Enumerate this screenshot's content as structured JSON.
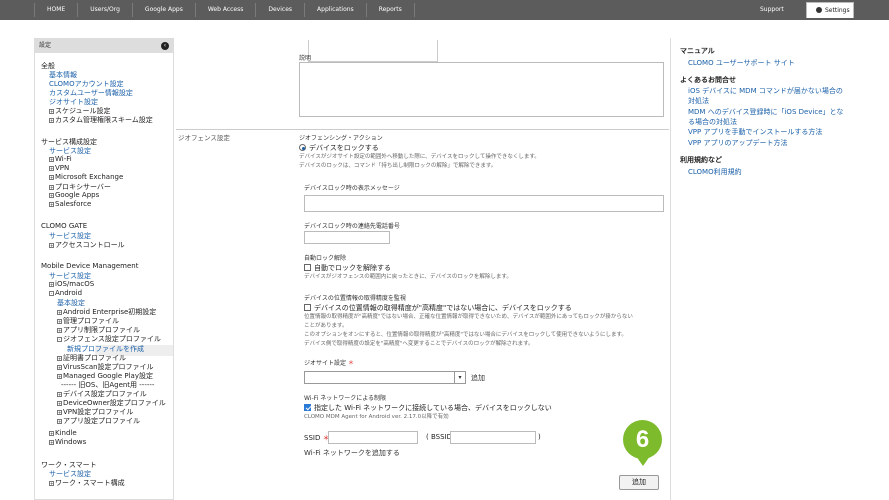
{
  "topnav": {
    "items": [
      "HOME",
      "Users/Org",
      "Google Apps",
      "Web Access",
      "Devices",
      "Applications",
      "Reports"
    ],
    "support": "Support",
    "settings": "Settings"
  },
  "sidebar": {
    "header": "設定",
    "general": {
      "title": "全般",
      "links": [
        "基本情報",
        "CLOMOアカウント設定",
        "カスタムユーザー情報設定",
        "ジオサイト設定"
      ],
      "items": [
        "スケジュール設定",
        "カスタム管理権限スキーム設定"
      ]
    },
    "service_config": {
      "title": "サービス構成設定",
      "link": "サービス設定",
      "items": [
        "Wi-Fi",
        "VPN",
        "Microsoft Exchange",
        "プロキシサーバー",
        "Google Apps",
        "Salesforce"
      ]
    },
    "gate": {
      "title": "CLOMO GATE",
      "link": "サービス設定",
      "items": [
        "アクセスコントロール"
      ]
    },
    "mdm": {
      "title": "Mobile Device Management",
      "link": "サービス設定",
      "ios": "iOS/macOS",
      "android": "Android",
      "android_basic": "基本設定",
      "android_items": [
        "Android Enterprise初期設定",
        "管理プロファイル",
        "アプリ制限プロファイル",
        "ジオフェンス設定プロファイル"
      ],
      "new_profile": "新規プロファイルを作成",
      "android_items2": [
        "証明書プロファイル",
        "VirusScan設定プロファイル",
        "Managed Google Play設定"
      ],
      "old_agent": "------ 旧OS、旧Agent用 ------",
      "android_items3": [
        "デバイス設定プロファイル",
        "DeviceOwner設定プロファイル",
        "VPN設定プロファイル",
        "アプリ設定プロファイル"
      ],
      "kindle": "Kindle",
      "windows": "Windows"
    },
    "ws": {
      "title": "ワーク・スマート",
      "link": "サービス設定",
      "items": [
        "ワーク・スマート構成"
      ]
    }
  },
  "main": {
    "description_label": "説明",
    "geofence_label": "ジオフェンス設定",
    "action_label": "ジオフェンシング・アクション",
    "lock_option": "デバイスをロックする",
    "lock_desc1": "デバイスがジオサイト設定の範囲外へ移動した際に、デバイスをロックして操作できなくします。",
    "lock_desc2": "デバイスのロックは、コマンド「持ち出し制限ロックの解除」で解除できます。",
    "lock_message_label": "デバイスロック時の表示メッセージ",
    "lock_phone_label": "デバイスロック時の連絡先電話番号",
    "auto_unlock_label": "自動ロック解除",
    "auto_unlock_option": "自動でロックを解除する",
    "auto_unlock_desc": "デバイスがジオフェンスの範囲内に戻ったときに、デバイスのロックを解除します。",
    "accuracy_label": "デバイスの位置情報の取得精度を監視",
    "accuracy_option": "デバイスの位置情報の取得精度が\"高精度\"ではない場合に、デバイスをロックする",
    "accuracy_desc1": "位置情報の取得精度が\"高精度\"ではない場合、正確な位置情報が取得できないため、デバイスが範囲外にあってもロックが掛からない",
    "accuracy_desc2": "ことがあります。",
    "accuracy_desc3": "このオプションをオンにすると、位置情報の取得精度が\"高精度\"ではない場合にデバイスをロックして使用できないようにします。",
    "accuracy_desc4": "デバイス側で取得精度の設定を\"高精度\"へ変更することでデバイスのロックが解除されます。",
    "geosite_label": "ジオサイト設定",
    "geosite_add": "追加",
    "wifi_label": "Wi-Fi ネットワークによる制限",
    "wifi_option": "指定した Wi-Fi ネットワークに接続している場合、デバイスをロックしない",
    "wifi_note": "CLOMO MDM Agent for Android ver. 2.17.0以降で有効",
    "ssid_label": "SSID",
    "bssid_label": "( BSSID",
    "bssid_close": ")",
    "add_wifi_link": "Wi-Fi ネットワークを追加する",
    "add_button": "追加",
    "step_badge": "6",
    "required_mark": "＊"
  },
  "right": {
    "manual_title": "マニュアル",
    "manual_link": "CLOMO ユーザーサポート サイト",
    "faq_title": "よくあるお問合せ",
    "faq_links": [
      "iOS デバイスに MDM コマンドが届かない場合の対処法",
      "MDM へのデバイス登録時に「iOS Device」となる場合の対処法",
      "VPP アプリを手動でインストールする方法",
      "VPP アプリのアップデート方法"
    ],
    "terms_title": "利用規約など",
    "terms_link": "CLOMO利用規約"
  }
}
